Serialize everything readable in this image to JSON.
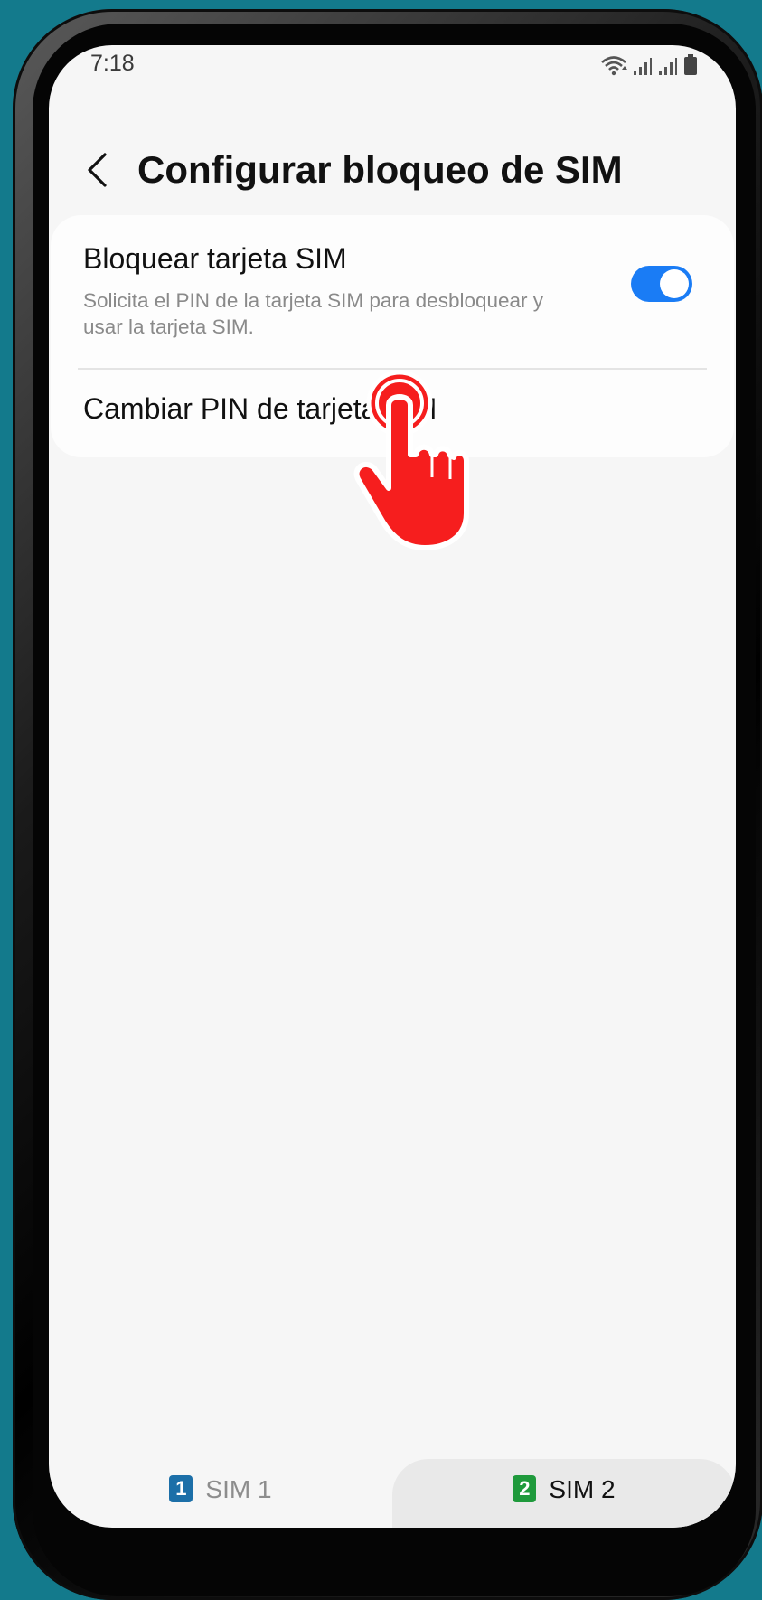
{
  "status_bar": {
    "time": "7:18"
  },
  "header": {
    "title": "Configurar bloqueo de SIM"
  },
  "settings": {
    "lock_sim": {
      "title": "Bloquear tarjeta SIM",
      "subtitle": "Solicita el PIN de la tarjeta SIM para desbloquear y usar la tarjeta SIM.",
      "enabled": true
    },
    "change_pin": {
      "title": "Cambiar PIN de tarjeta SIM"
    }
  },
  "sim_tabs": [
    {
      "badge": "1",
      "label": "SIM 1",
      "selected": false,
      "badge_color": "#1c6fa8"
    },
    {
      "badge": "2",
      "label": "SIM 2",
      "selected": true,
      "badge_color": "#1f9a3c"
    }
  ],
  "colors": {
    "toggle_on": "#1a7cf5",
    "pointer_hand": "#f61e1e",
    "background_outer": "#137a8c"
  }
}
